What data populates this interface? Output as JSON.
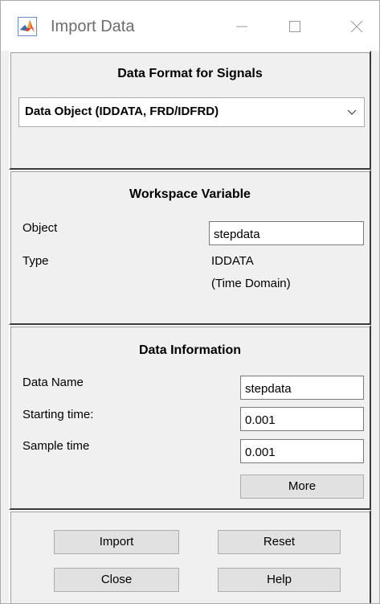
{
  "window": {
    "title": "Import Data",
    "icon": "matlab-icon"
  },
  "format_panel": {
    "heading": "Data Format for Signals",
    "dropdown_value": "Data Object (IDDATA, FRD/IDFRD)"
  },
  "workspace_panel": {
    "heading": "Workspace Variable",
    "object_label": "Object",
    "object_value": "stepdata",
    "type_label": "Type",
    "type_value_line1": "IDDATA",
    "type_value_line2": "(Time Domain)"
  },
  "info_panel": {
    "heading": "Data Information",
    "data_name_label": "Data Name",
    "data_name_value": "stepdata",
    "starting_time_label": "Starting time:",
    "starting_time_value": "0.001",
    "sample_time_label": "Sample time",
    "sample_time_value": "0.001",
    "more_label": "More"
  },
  "actions": {
    "import_label": "Import",
    "reset_label": "Reset",
    "close_label": "Close",
    "help_label": "Help"
  }
}
